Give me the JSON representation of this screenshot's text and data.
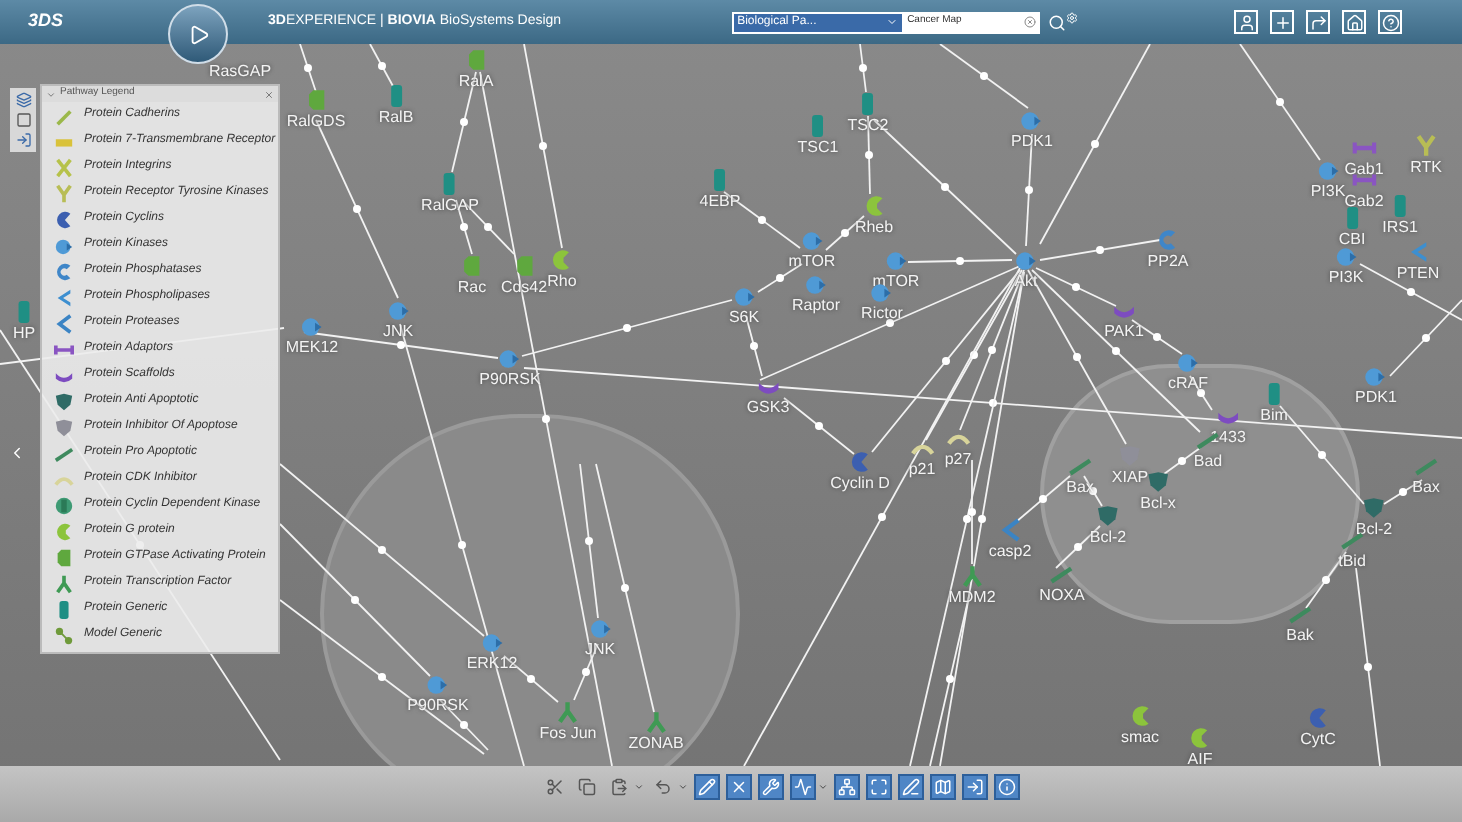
{
  "header": {
    "brand_mark": "3DS",
    "title": "**3D**EXPERIENCE | **BIOVIA** BioSystems Design",
    "dropdown": {
      "value": "Biological Pa..."
    },
    "search": {
      "value": "Cancer Map"
    }
  },
  "legend": {
    "title": "Pathway Legend",
    "items": [
      {
        "kind": "cadherin",
        "label": "Protein Cadherins"
      },
      {
        "kind": "gpcr",
        "label": "Protein 7-Transmembrane Receptor"
      },
      {
        "kind": "integrin",
        "label": "Protein Integrins"
      },
      {
        "kind": "rtk",
        "label": "Protein Receptor Tyrosine Kinases"
      },
      {
        "kind": "cyclin",
        "label": "Protein Cyclins"
      },
      {
        "kind": "kinase",
        "label": "Protein Kinases"
      },
      {
        "kind": "phosphatase",
        "label": "Protein Phosphatases"
      },
      {
        "kind": "phospholipase",
        "label": "Protein Phospholipases"
      },
      {
        "kind": "protease",
        "label": "Protein Proteases"
      },
      {
        "kind": "adaptor",
        "label": "Protein Adaptors"
      },
      {
        "kind": "scaffold",
        "label": "Protein Scaffolds"
      },
      {
        "kind": "anti_apoptotic",
        "label": "Protein Anti Apoptotic"
      },
      {
        "kind": "iap",
        "label": "Protein Inhibitor Of Apoptose"
      },
      {
        "kind": "pro_apoptotic",
        "label": "Protein Pro Apoptotic"
      },
      {
        "kind": "cdk_inhibitor",
        "label": "Protein CDK Inhibitor"
      },
      {
        "kind": "cdk",
        "label": "Protein Cyclin Dependent Kinase"
      },
      {
        "kind": "g_protein",
        "label": "Protein G protein"
      },
      {
        "kind": "gap",
        "label": "Protein GTPase Activating Protein"
      },
      {
        "kind": "tf",
        "label": "Protein Transcription Factor"
      },
      {
        "kind": "generic",
        "label": "Protein Generic"
      },
      {
        "kind": "model",
        "label": "Model Generic"
      }
    ]
  },
  "nodes": [
    {
      "kind": "none",
      "label": "RasGAP"
    },
    {
      "kind": "gap",
      "label": "RalA"
    },
    {
      "kind": "gap",
      "label": "RalGDS"
    },
    {
      "kind": "generic",
      "label": "RalB"
    },
    {
      "kind": "generic",
      "label": "RalGAP"
    },
    {
      "kind": "gap",
      "label": "Rac"
    },
    {
      "kind": "gap",
      "label": "Cds42"
    },
    {
      "kind": "g_protein",
      "label": "Rho"
    },
    {
      "kind": "kinase",
      "label": "JNK"
    },
    {
      "kind": "kinase",
      "label": "MEK12"
    },
    {
      "kind": "kinase",
      "label": "P90RSK"
    },
    {
      "kind": "generic",
      "label": "4EBP"
    },
    {
      "kind": "generic",
      "label": "TSC1"
    },
    {
      "kind": "generic",
      "label": "TSC2"
    },
    {
      "kind": "g_protein",
      "label": "Rheb"
    },
    {
      "kind": "kinase",
      "label": "mTOR"
    },
    {
      "kind": "kinase",
      "label": "Raptor"
    },
    {
      "kind": "kinase",
      "label": "mTOR"
    },
    {
      "kind": "kinase",
      "label": "S6K"
    },
    {
      "kind": "kinase",
      "label": "Rictor"
    },
    {
      "kind": "scaffold",
      "label": "GSK3"
    },
    {
      "kind": "cyclin",
      "label": "Cyclin D"
    },
    {
      "kind": "cdk_inhibitor",
      "label": "p21"
    },
    {
      "kind": "cdk_inhibitor",
      "label": "p27"
    },
    {
      "kind": "kinase",
      "label": "PDK1"
    },
    {
      "kind": "kinase",
      "label": "Akt"
    },
    {
      "kind": "phosphatase",
      "label": "PP2A"
    },
    {
      "kind": "scaffold",
      "label": "PAK1"
    },
    {
      "kind": "kinase",
      "label": "cRAF"
    },
    {
      "kind": "scaffold",
      "label": "1433"
    },
    {
      "kind": "generic",
      "label": "Bim"
    },
    {
      "kind": "pro_apoptotic",
      "label": "Bad"
    },
    {
      "kind": "iap",
      "label": "XIAP"
    },
    {
      "kind": "anti_apoptotic",
      "label": "Bcl-x"
    },
    {
      "kind": "pro_apoptotic",
      "label": "Bax"
    },
    {
      "kind": "protease",
      "label": "casp2"
    },
    {
      "kind": "anti_apoptotic",
      "label": "Bcl-2"
    },
    {
      "kind": "tf",
      "label": "MDM2"
    },
    {
      "kind": "pro_apoptotic",
      "label": "NOXA"
    },
    {
      "kind": "adaptor",
      "label": "Gab1"
    },
    {
      "kind": "adaptor",
      "label": "Gab2"
    },
    {
      "kind": "kinase",
      "label": "PI3K"
    },
    {
      "kind": "rtk",
      "label": "RTK"
    },
    {
      "kind": "generic",
      "label": "CBI"
    },
    {
      "kind": "generic",
      "label": "IRS1"
    },
    {
      "kind": "kinase",
      "label": "PI3K"
    },
    {
      "kind": "phospholipase",
      "label": "PTEN"
    },
    {
      "kind": "kinase",
      "label": "PDK1"
    },
    {
      "kind": "pro_apoptotic",
      "label": "Bax"
    },
    {
      "kind": "anti_apoptotic",
      "label": "Bcl-2"
    },
    {
      "kind": "pro_apoptotic",
      "label": "tBid"
    },
    {
      "kind": "pro_apoptotic",
      "label": "Bak"
    },
    {
      "kind": "kinase",
      "label": "ERK12"
    },
    {
      "kind": "kinase",
      "label": "JNK"
    },
    {
      "kind": "kinase",
      "label": "P90RSK"
    },
    {
      "kind": "tf",
      "label": "Fos Jun"
    },
    {
      "kind": "tf",
      "label": "ZONAB"
    },
    {
      "kind": "g_protein",
      "label": "smac"
    },
    {
      "kind": "g_protein",
      "label": "AIF"
    },
    {
      "kind": "cyclin",
      "label": "CytC"
    },
    {
      "kind": "generic",
      "label": "HP"
    }
  ]
}
